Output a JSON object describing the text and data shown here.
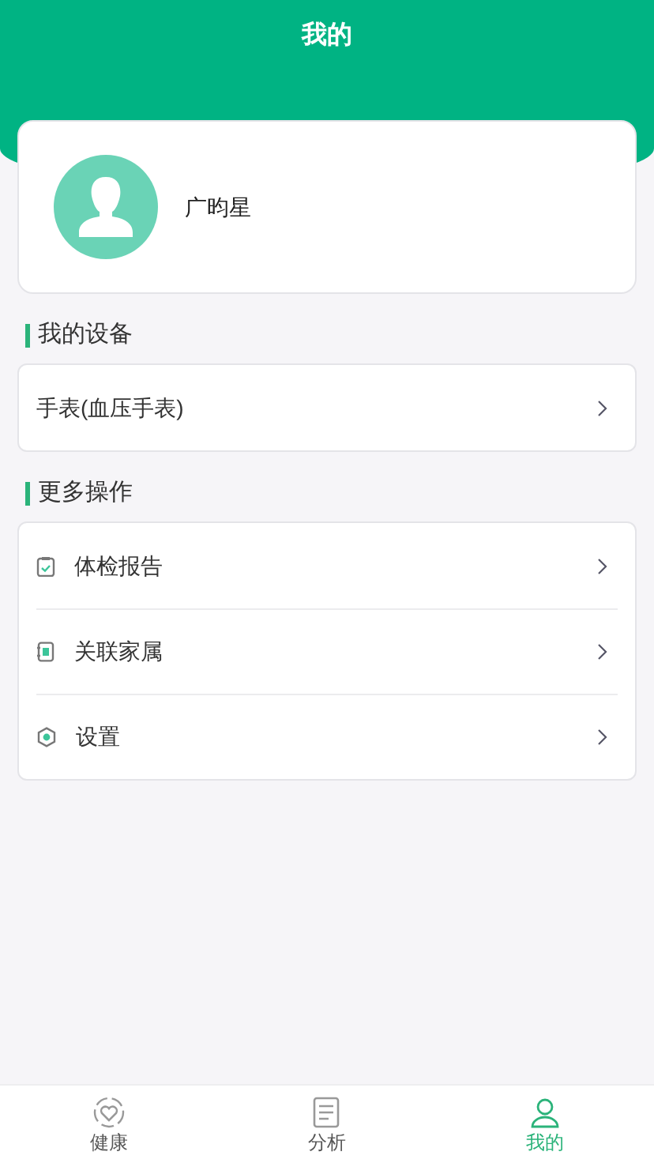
{
  "header": {
    "title": "我的"
  },
  "profile": {
    "name": "广昀星"
  },
  "sections": [
    {
      "title": "我的设备",
      "items": [
        {
          "label": "手表(血压手表)",
          "kind": "plain"
        }
      ]
    },
    {
      "title": "更多操作",
      "items": [
        {
          "label": "体检报告",
          "kind": "report"
        },
        {
          "label": "关联家属",
          "kind": "family"
        },
        {
          "label": "设置",
          "kind": "settings"
        }
      ]
    }
  ],
  "tabbar": [
    {
      "label": "健康",
      "kind": "health",
      "selected": false
    },
    {
      "label": "分析",
      "kind": "analysis",
      "selected": false
    },
    {
      "label": "我的",
      "kind": "me",
      "selected": true
    }
  ]
}
